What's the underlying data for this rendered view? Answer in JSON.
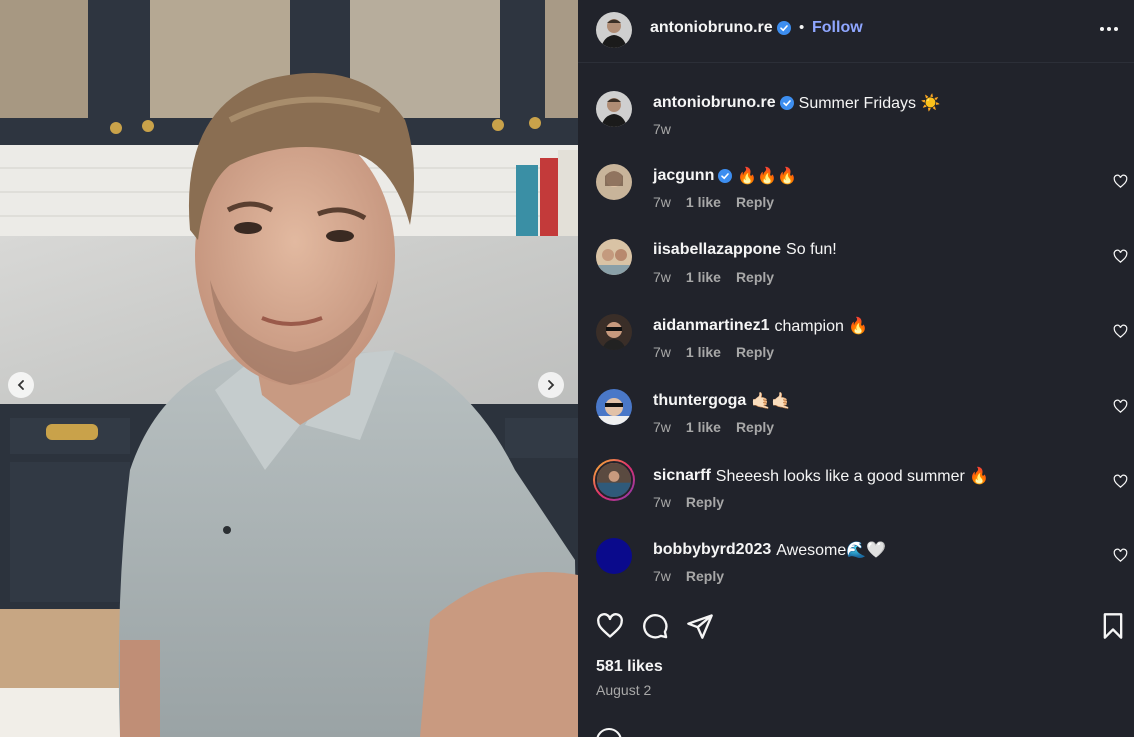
{
  "post": {
    "username": "antoniobruno.re",
    "follow_label": "Follow",
    "separator": "•",
    "caption_text": "Summer Fridays ☀️",
    "caption_time": "7w",
    "likes": "581 likes",
    "date": "August 2"
  },
  "comments": [
    {
      "username": "jacgunn",
      "verified": true,
      "text": "🔥🔥🔥",
      "time": "7w",
      "likes": "1 like",
      "reply": "Reply",
      "avatar_color": "#c8b49a"
    },
    {
      "username": "iisabellazappone",
      "verified": false,
      "text": "So fun!",
      "time": "7w",
      "likes": "1 like",
      "reply": "Reply",
      "avatar_color": "#d9c3a5"
    },
    {
      "username": "aidanmartinez1",
      "verified": false,
      "text": "champion 🔥",
      "time": "7w",
      "likes": "1 like",
      "reply": "Reply",
      "avatar_color": "#6a5548"
    },
    {
      "username": "thuntergoga",
      "verified": false,
      "text": "🤙🏻🤙🏻",
      "time": "7w",
      "likes": "1 like",
      "reply": "Reply",
      "avatar_color": "#4a78c8"
    },
    {
      "username": "sicnarff",
      "verified": false,
      "text": "Sheeesh looks like a good summer 🔥",
      "time": "7w",
      "likes": "",
      "reply": "Reply",
      "avatar_color": "#5a4a40"
    },
    {
      "username": "bobbybyrd2023",
      "verified": false,
      "text": "Awesome🌊🤍",
      "time": "7w",
      "likes": "",
      "reply": "Reply",
      "avatar_color": "#0a0a8c"
    }
  ],
  "icons": {
    "verified": "verified-badge-icon",
    "more": "more-options-icon",
    "like": "heart-icon",
    "comment": "comment-icon",
    "share": "send-icon",
    "save": "bookmark-icon",
    "prev": "chevron-left-icon",
    "next": "chevron-right-icon"
  },
  "colors": {
    "panel_bg": "#21232b",
    "accent_link": "#8fa6ff",
    "verified_blue": "#3d8ef0",
    "muted_text": "#a8a8a8"
  }
}
